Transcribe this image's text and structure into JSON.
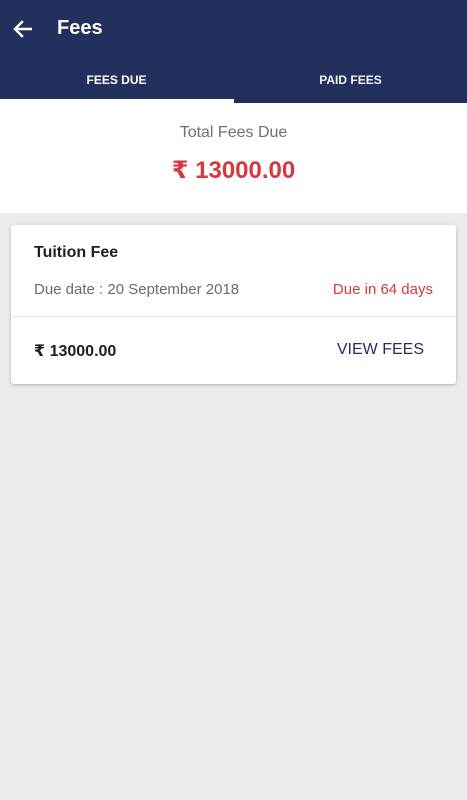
{
  "header": {
    "title": "Fees",
    "back_icon": "arrow-left-icon"
  },
  "tabs": [
    {
      "label": "FEES DUE",
      "active": true
    },
    {
      "label": "PAID FEES",
      "active": false
    }
  ],
  "summary": {
    "label": "Total Fees Due",
    "amount": "₹ 13000.00"
  },
  "fees": [
    {
      "name": "Tuition Fee",
      "due_date": "Due date : 20 September 2018",
      "due_status": "Due in 64 days",
      "amount": "₹ 13000.00",
      "action_label": "VIEW FEES"
    }
  ],
  "colors": {
    "primary": "#23305e",
    "accent_red": "#d6393d",
    "background": "#ebebeb"
  }
}
